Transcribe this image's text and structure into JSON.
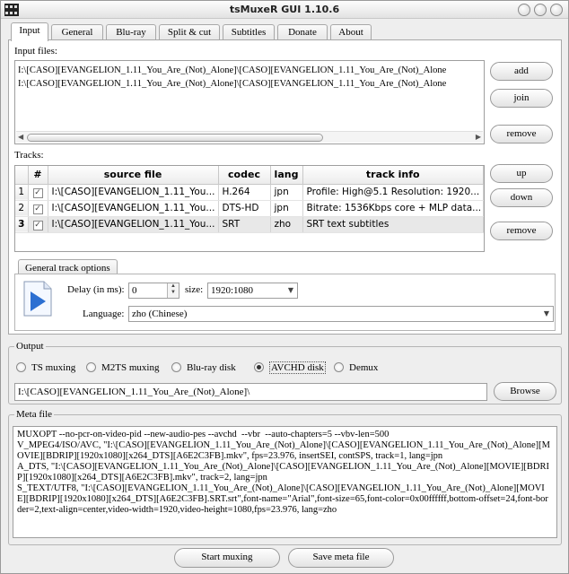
{
  "window": {
    "title": "tsMuxeR GUI 1.10.6"
  },
  "tabs": [
    {
      "label": "Input"
    },
    {
      "label": "General"
    },
    {
      "label": "Blu-ray"
    },
    {
      "label": "Split & cut"
    },
    {
      "label": "Subtitles"
    },
    {
      "label": "Donate"
    },
    {
      "label": "About"
    }
  ],
  "input": {
    "files_label": "Input files:",
    "files": [
      "I:\\[CASO][EVANGELION_1.11_You_Are_(Not)_Alone]\\[CASO][EVANGELION_1.11_You_Are_(Not)_Alone",
      "I:\\[CASO][EVANGELION_1.11_You_Are_(Not)_Alone]\\[CASO][EVANGELION_1.11_You_Are_(Not)_Alone"
    ],
    "add_label": "add",
    "join_label": "join",
    "remove_label": "remove",
    "tracks_label": "Tracks:",
    "up_label": "up",
    "down_label": "down",
    "remove_track_label": "remove"
  },
  "tracks": {
    "headers": [
      "#",
      "source file",
      "codec",
      "lang",
      "track info"
    ],
    "rows": [
      {
        "num": "1",
        "file": "I:\\[CASO][EVANGELION_1.11_You...",
        "codec": "H.264",
        "lang": "jpn",
        "info": "Profile: High@5.1  Resolution: 1920..."
      },
      {
        "num": "2",
        "file": "I:\\[CASO][EVANGELION_1.11_You...",
        "codec": "DTS-HD",
        "lang": "jpn",
        "info": "Bitrate: 1536Kbps  core + MLP data..."
      },
      {
        "num": "3",
        "file": "I:\\[CASO][EVANGELION_1.11_You...",
        "codec": "SRT",
        "lang": "zho",
        "info": "SRT text subtitles"
      }
    ]
  },
  "track_options": {
    "tab_label": "General track options",
    "delay_label": "Delay (in ms):",
    "delay_value": "0",
    "size_label": "size:",
    "size_value": "1920:1080",
    "language_label": "Language:",
    "language_value": "zho (Chinese)"
  },
  "output": {
    "legend": "Output",
    "options": [
      "TS muxing",
      "M2TS muxing",
      "Blu-ray disk",
      "AVCHD disk",
      "Demux"
    ],
    "selected": "AVCHD disk",
    "path": "I:\\[CASO][EVANGELION_1.11_You_Are_(Not)_Alone]\\",
    "browse_label": "Browse"
  },
  "meta": {
    "legend": "Meta file",
    "text": "MUXOPT --no-pcr-on-video-pid --new-audio-pes --avchd  --vbr  --auto-chapters=5 --vbv-len=500\nV_MPEG4/ISO/AVC, \"I:\\[CASO][EVANGELION_1.11_You_Are_(Not)_Alone]\\[CASO][EVANGELION_1.11_You_Are_(Not)_Alone][MOVIE][BDRIP][1920x1080][x264_DTS][A6E2C3FB].mkv\", fps=23.976, insertSEI, contSPS, track=1, lang=jpn\nA_DTS, \"I:\\[CASO][EVANGELION_1.11_You_Are_(Not)_Alone]\\[CASO][EVANGELION_1.11_You_Are_(Not)_Alone][MOVIE][BDRIP][1920x1080][x264_DTS][A6E2C3FB].mkv\", track=2, lang=jpn\nS_TEXT/UTF8, \"I:\\[CASO][EVANGELION_1.11_You_Are_(Not)_Alone]\\[CASO][EVANGELION_1.11_You_Are_(Not)_Alone][MOVIE][BDRIP][1920x1080][x264_DTS][A6E2C3FB].SRT.srt\",font-name=\"Arial\",font-size=65,font-color=0x00ffffff,bottom-offset=24,font-border=2,text-align=center,video-width=1920,video-height=1080,fps=23.976, lang=zho"
  },
  "actions": {
    "start_label": "Start muxing",
    "save_label": "Save meta file"
  }
}
